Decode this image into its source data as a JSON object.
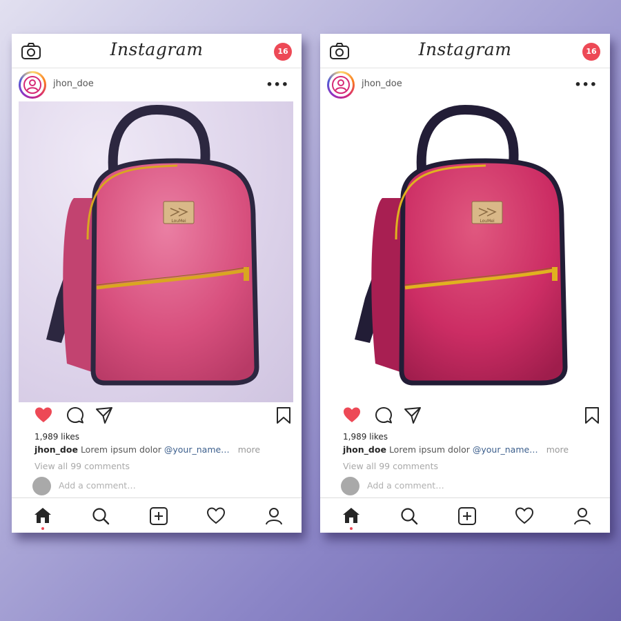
{
  "app": {
    "title": "Instagram"
  },
  "colors": {
    "badge": "#ed4956",
    "like": "#ed4956",
    "mention": "#3b5e8c",
    "bag_left": "#d8507e",
    "bag_right": "#cc2d64"
  },
  "posts": [
    {
      "notification_count": "16",
      "username": "jhon_doe",
      "image": {
        "subject": "pink mini backpack",
        "brand_tag": "LouMei"
      },
      "liked": true,
      "likes": "1,989 likes",
      "caption": {
        "user": "jhon_doe",
        "text": "Lorem ipsum dolor",
        "mention": "@your_name…",
        "more": "more"
      },
      "view_comments": "View all 99 comments",
      "comment_placeholder": "Add a comment…"
    },
    {
      "notification_count": "16",
      "username": "jhon_doe",
      "image": {
        "subject": "pink mini backpack",
        "brand_tag": "LouMei"
      },
      "liked": true,
      "likes": "1,989 likes",
      "caption": {
        "user": "jhon_doe",
        "text": "Lorem ipsum dolor",
        "mention": "@your_name…",
        "more": "more"
      },
      "view_comments": "View all 99 comments",
      "comment_placeholder": "Add a comment…"
    }
  ],
  "icons": [
    "camera-icon",
    "more-icon",
    "heart-icon",
    "comment-icon",
    "share-icon",
    "bookmark-icon",
    "home-icon",
    "search-icon",
    "add-post-icon",
    "activity-icon",
    "profile-icon"
  ]
}
